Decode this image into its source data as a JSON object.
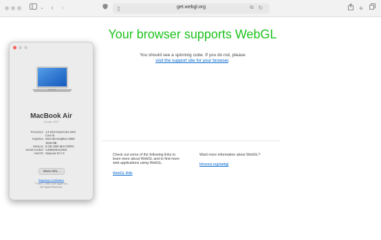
{
  "browser": {
    "url": "get.webgl.org",
    "icons": {
      "sidebar": "sidebar-icon",
      "back": "chevron-left-icon",
      "forward": "chevron-right-icon",
      "shield": "shield-icon",
      "page": "page-icon",
      "translate": "translate-icon",
      "reload": "reload-icon",
      "share": "share-icon",
      "new_tab": "plus-icon",
      "tabs": "tabs-overview-icon"
    }
  },
  "page": {
    "headline": "Your browser supports WebGL",
    "sub_line": "You should see a spinning cube. If you do not, please",
    "sub_link": "visit the support site for your browser",
    "sub_end": ".",
    "left_col": {
      "text_1": "Check out some of the following links to",
      "text_2": "learn more about WebGL and to find more",
      "text_3": "web applications using WebGL.",
      "link": "WebGL Wiki"
    },
    "right_col": {
      "text": "Want more information about WebGL?",
      "link": "khronos.org/webgl"
    },
    "colors": {
      "headline": "#1cc21c",
      "link": "#0066cc"
    }
  },
  "about_mac": {
    "title": "MacBook Air",
    "year": "13-inch, 2017",
    "specs": [
      {
        "key": "Processor",
        "value": "1.8 GHz Dual-Core Intel Core i5"
      },
      {
        "key": "Graphics",
        "value": "Intel HD Graphics 6000 1536 MB"
      },
      {
        "key": "Memory",
        "value": "8 GB 1600 MHz DDR3"
      },
      {
        "key": "Serial number",
        "value": "C2WDH0J1GWX"
      },
      {
        "key": "macOS",
        "value": "Sequoia 15.7.3"
      }
    ],
    "more_button": "More Info...",
    "regulatory": "Regulatory Certification",
    "copyright_1": "™ and © 1983-2025 Apple Inc.",
    "copyright_2": "All Rights Reserved."
  }
}
